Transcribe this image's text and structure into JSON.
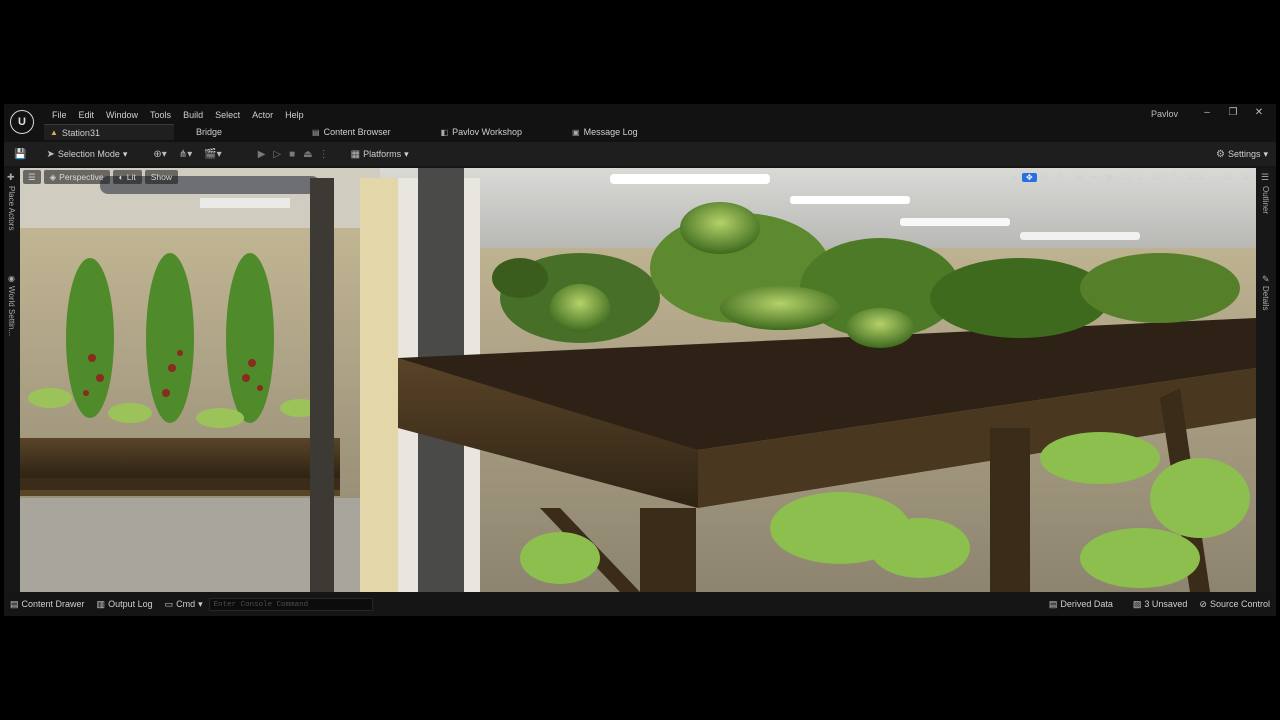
{
  "menubar": {
    "items": [
      "File",
      "Edit",
      "Window",
      "Tools",
      "Build",
      "Select",
      "Actor",
      "Help"
    ],
    "project": "Pavlov",
    "window_controls": [
      "minimize-icon",
      "restore-icon",
      "close-icon"
    ]
  },
  "tabs": [
    {
      "label": "Station31",
      "icon": "level-icon"
    },
    {
      "label": "Bridge",
      "icon": ""
    },
    {
      "label": "Content Browser",
      "icon": "folder-icon"
    },
    {
      "label": "Pavlov Workshop",
      "icon": "workshop-icon"
    },
    {
      "label": "Message Log",
      "icon": "log-icon"
    }
  ],
  "toolbar": {
    "selection_mode": "Selection Mode",
    "platforms": "Platforms",
    "settings": "Settings"
  },
  "viewport": {
    "perspective": "Perspective",
    "lit": "Lit",
    "show": "Show",
    "grid_snap": "10",
    "rotation_snap": "10°",
    "scale_snap": "0.25",
    "camera_speed": "4"
  },
  "left_panel": {
    "place_actors": "Place Actors",
    "world_settings": "World Settin..."
  },
  "right_panel": {
    "outliner": "Outliner",
    "details": "Details"
  },
  "statusbar": {
    "content_drawer": "Content Drawer",
    "output_log": "Output Log",
    "cmd": "Cmd",
    "console_placeholder": "Enter Console Command",
    "derived_data": "Derived Data",
    "unsaved": "3 Unsaved",
    "source_control": "Source Control"
  }
}
